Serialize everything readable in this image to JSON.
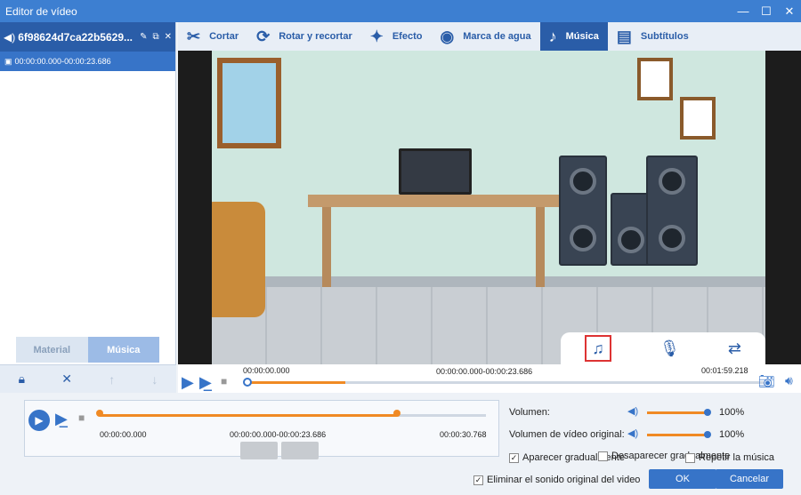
{
  "window": {
    "title": "Editor de vídeo",
    "minimize": "—",
    "maximize": "☐",
    "close": "✕"
  },
  "left": {
    "file_name": "6f98624d7ca22b5629...",
    "clip_range": "00:00:00.000-00:00:23.686",
    "tabs": [
      "Material",
      "Música"
    ]
  },
  "toolbar": {
    "items": [
      {
        "label": "Cortar",
        "icon": "cut-icon"
      },
      {
        "label": "Rotar y recortar",
        "icon": "rotate-crop-icon"
      },
      {
        "label": "Efecto",
        "icon": "effect-icon"
      },
      {
        "label": "Marca de agua",
        "icon": "watermark-icon"
      },
      {
        "label": "Música",
        "icon": "music-note-icon",
        "active": true
      },
      {
        "label": "Subtítulos",
        "icon": "subtitle-icon"
      }
    ]
  },
  "playback": {
    "start": "00:00:00.000",
    "range": "00:00:00.000-00:00:23.686",
    "end": "00:01:59.218",
    "progress_fraction": 0.19
  },
  "music": {
    "start": "00:00:00.000",
    "range": "00:00:00.000-00:00:23.686",
    "end": "00:00:30.768"
  },
  "audio": {
    "volume_label": "Volumen:",
    "volume_value": "100%",
    "orig_volume_label": "Volumen de vídeo original:",
    "orig_volume_value": "100%"
  },
  "options": {
    "fade_in": "Aparecer gradualmente",
    "fade_out": "Desaparecer gradualmente",
    "repeat": "Repetir la música",
    "remove_orig": "Eliminar el sonido original del video"
  },
  "buttons": {
    "ok": "OK",
    "cancel": "Cancelar"
  }
}
